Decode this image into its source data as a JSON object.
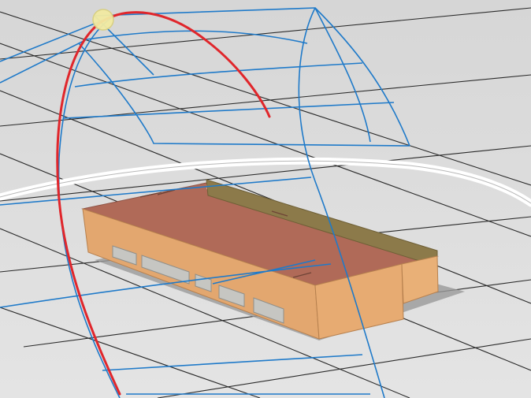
{
  "viewport": {
    "kind": "3d-sun-path-view",
    "background_color": "#dcdcdc",
    "grid_color": "#2a2a2a",
    "sun_path_color": "#e0262b",
    "sun_chart_color": "#1f7ac9",
    "sun_marker_color": "#f2eaa2",
    "horizon_ring_color": "#ffffff",
    "building": {
      "roof_color": "#b06a58",
      "wall_color": "#e3a76f",
      "parapet_color": "#8c7a4a",
      "window_color": "#c6c6c2",
      "shadow_color": "#9a9a9a"
    }
  }
}
